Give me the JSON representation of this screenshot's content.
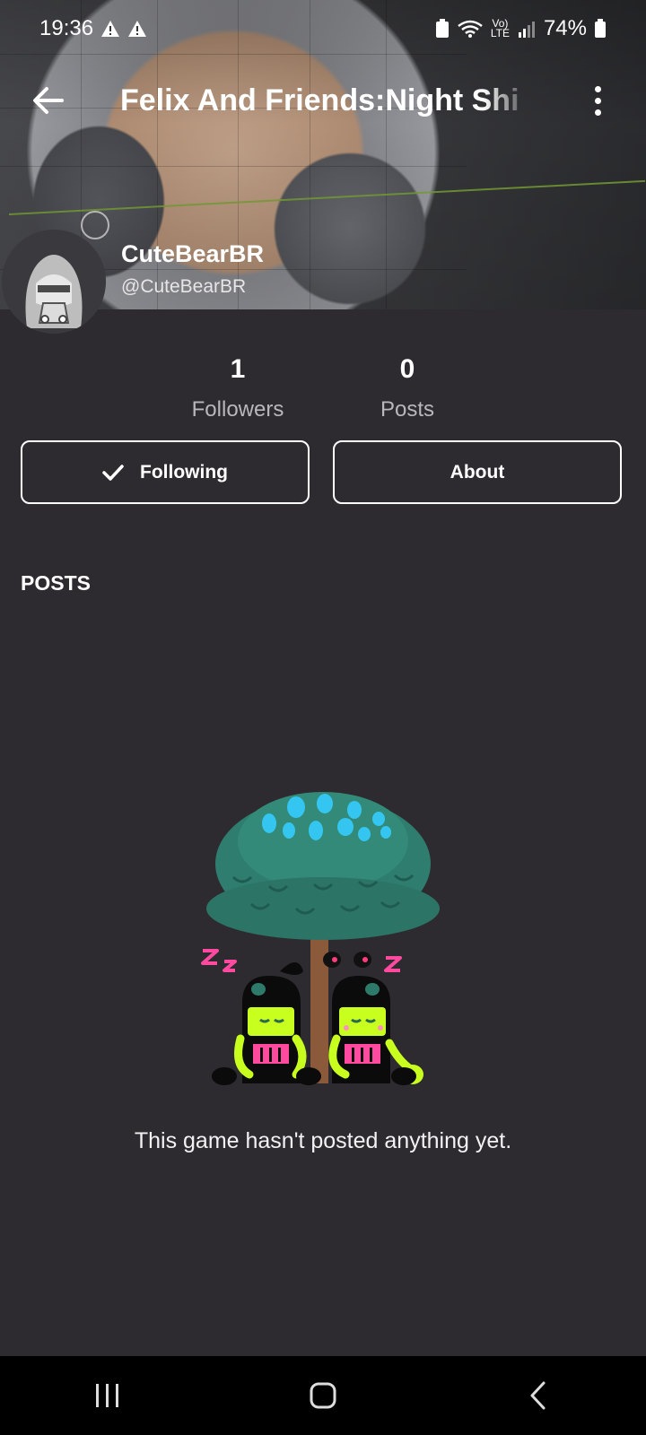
{
  "status_bar": {
    "time": "19:36",
    "battery": "74%"
  },
  "header": {
    "title": "Felix And Friends:Night Shi"
  },
  "creator": {
    "name": "CuteBearBR",
    "handle": "@CuteBearBR"
  },
  "stats": {
    "followers_count": "1",
    "followers_label": "Followers",
    "posts_count": "0",
    "posts_label": "Posts"
  },
  "actions": {
    "following_label": "Following",
    "about_label": "About"
  },
  "posts_section": {
    "title": "POSTS",
    "empty_message": "This game hasn't posted anything yet."
  },
  "colors": {
    "background": "#2d2a30",
    "navbar": "#000000",
    "button_border": "#ffffff"
  }
}
